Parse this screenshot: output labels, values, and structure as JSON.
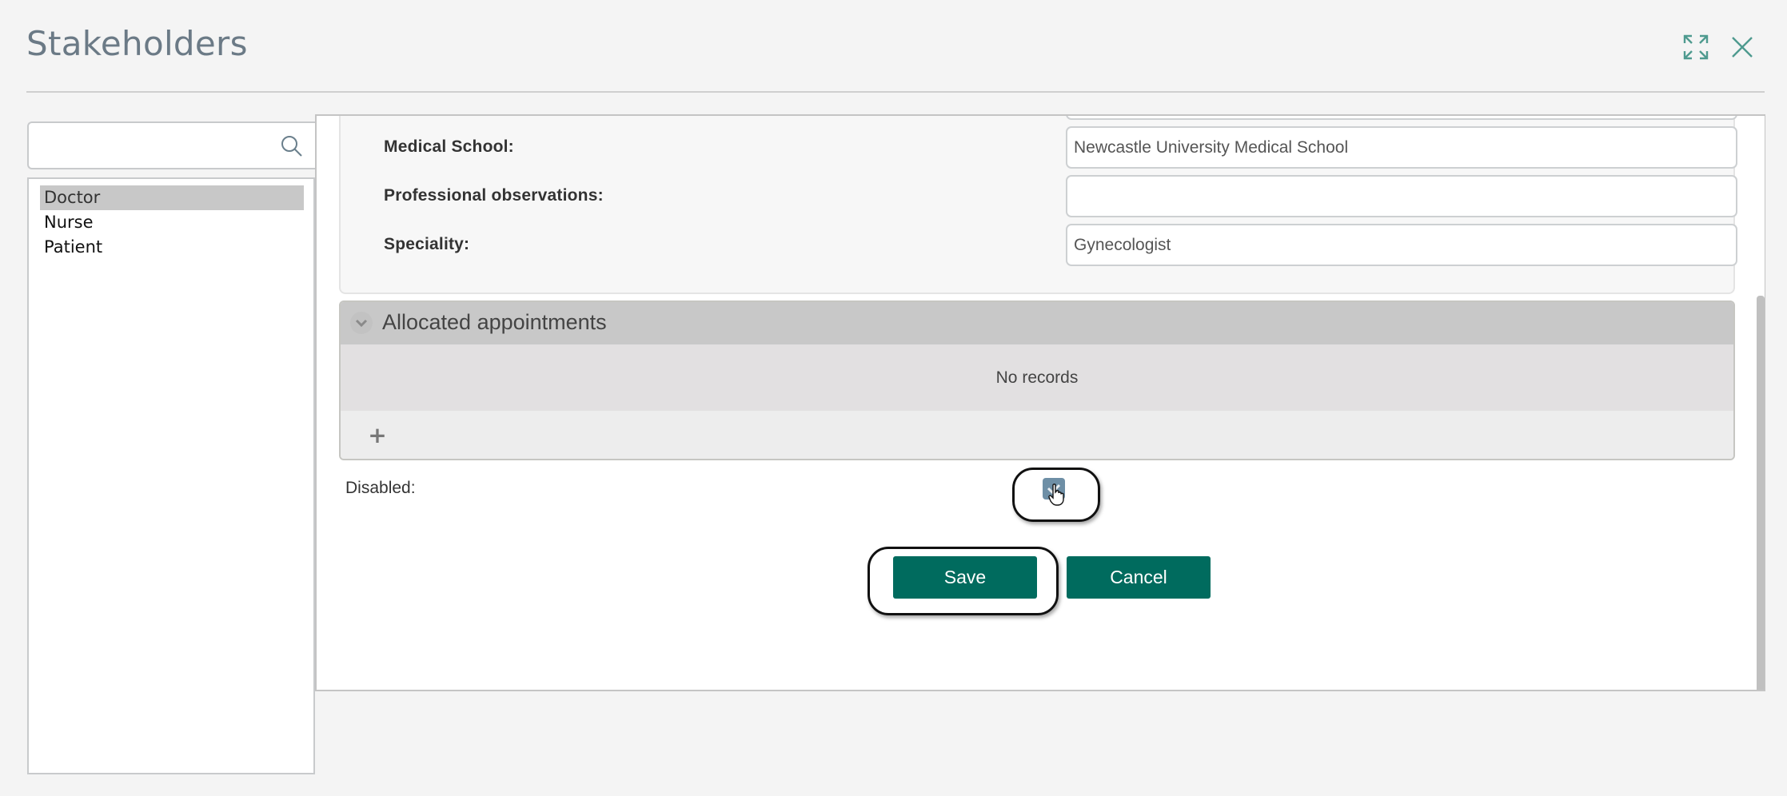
{
  "header": {
    "title": "Stakeholders",
    "expand_icon": "expand-icon",
    "close_icon": "close-icon",
    "accent_color": "#4e9a8f"
  },
  "sidebar": {
    "search": {
      "value": "",
      "placeholder": "",
      "icon": "search-icon"
    },
    "items": [
      {
        "label": "Doctor",
        "selected": true
      },
      {
        "label": "Nurse",
        "selected": false
      },
      {
        "label": "Patient",
        "selected": false
      }
    ]
  },
  "form": {
    "fields": [
      {
        "label": "Medical School:",
        "value": "Newcastle University Medical School"
      },
      {
        "label": "Professional observations:",
        "value": ""
      },
      {
        "label": "Speciality:",
        "value": "Gynecologist"
      }
    ],
    "appointments": {
      "title": "Allocated appointments",
      "empty_text": "No records",
      "add_label": "+"
    },
    "disabled": {
      "label": "Disabled:",
      "checked": true
    },
    "buttons": {
      "save": "Save",
      "cancel": "Cancel"
    },
    "button_color": "#006b5e"
  }
}
